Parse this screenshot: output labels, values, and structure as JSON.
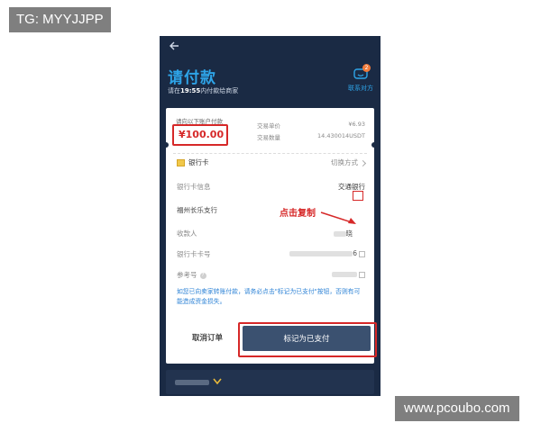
{
  "watermarks": {
    "top_left": "TG: MYYJJPP",
    "bottom_right": "www.pcoubo.com"
  },
  "header": {
    "back_icon": "arrow-left-icon",
    "title": "请付款",
    "subtitle_prefix": "请在",
    "subtitle_time": "19:55",
    "subtitle_suffix": "内付款给商家",
    "contact_label": "联系对方",
    "contact_badge": "2",
    "contact_icon": "chat-face-icon"
  },
  "order": {
    "pay_label": "请向以下账户付款",
    "amount": "¥100.00",
    "unit_price_label": "交易单价",
    "unit_price": "¥6.93",
    "quantity_label": "交易数量",
    "quantity": "14.430014USDT"
  },
  "payment": {
    "method_label": "银行卡",
    "switch_label": "切换方式",
    "bank_info_label": "银行卡信息",
    "bank_name": "交通银行",
    "branch": "福州长乐支行",
    "copy_tip": "点击复制",
    "payee_label": "收款人",
    "payee_tail": "晓",
    "card_no_label": "银行卡卡号",
    "card_no_tail": "6",
    "ref_label": "参考号",
    "ref_help_icon": "question-icon"
  },
  "notice": "如您已向卖家转账付款，请务必点击\"标记为已支付\"按钮，否则有可能造成资金损失。",
  "actions": {
    "cancel": "取消订单",
    "mark_paid": "标记为已支付"
  },
  "colors": {
    "accent": "#2ea4e8",
    "highlight": "#d62828",
    "bg": "#1a2a44",
    "button": "#3b5170"
  }
}
